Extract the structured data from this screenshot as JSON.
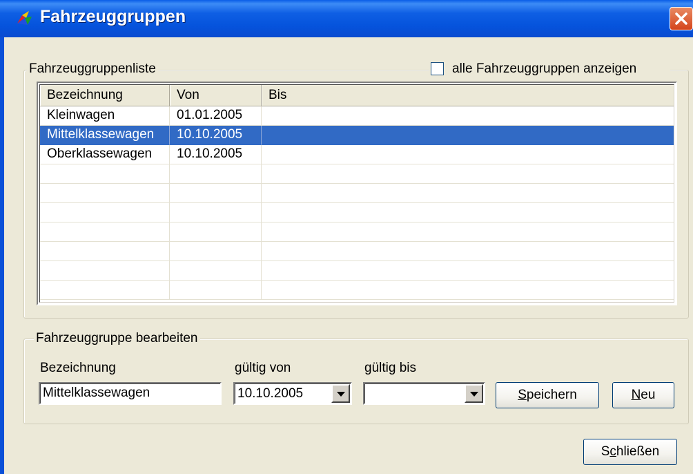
{
  "window": {
    "title": "Fahrzeuggruppen"
  },
  "list_group": {
    "legend": "Fahrzeuggruppenliste",
    "show_all_label": "alle Fahrzeuggruppen anzeigen",
    "show_all_checked": false,
    "columns": [
      "Bezeichnung",
      "Von",
      "Bis"
    ],
    "rows": [
      [
        "Kleinwagen",
        "01.01.2005",
        ""
      ],
      [
        "Mittelklassewagen",
        "10.10.2005",
        ""
      ],
      [
        "Oberklassewagen",
        "10.10.2005",
        ""
      ]
    ],
    "selected_row": 1
  },
  "edit_group": {
    "legend": "Fahrzeuggruppe bearbeiten",
    "name_label": "Bezeichnung",
    "name_value": "Mittelklassewagen",
    "from_label": "gültig von",
    "from_value": "10.10.2005",
    "to_label": "gültig bis",
    "to_value": "",
    "save_button": {
      "mnemonic": "S",
      "rest": "peichern"
    },
    "new_button": {
      "mnemonic": "N",
      "rest": "eu"
    }
  },
  "close_button": {
    "pre": "S",
    "mnemonic": "c",
    "rest": "hließen"
  },
  "colors": {
    "titlebar": "#0553dc",
    "selection": "#316ac5",
    "face": "#ece9d8"
  }
}
